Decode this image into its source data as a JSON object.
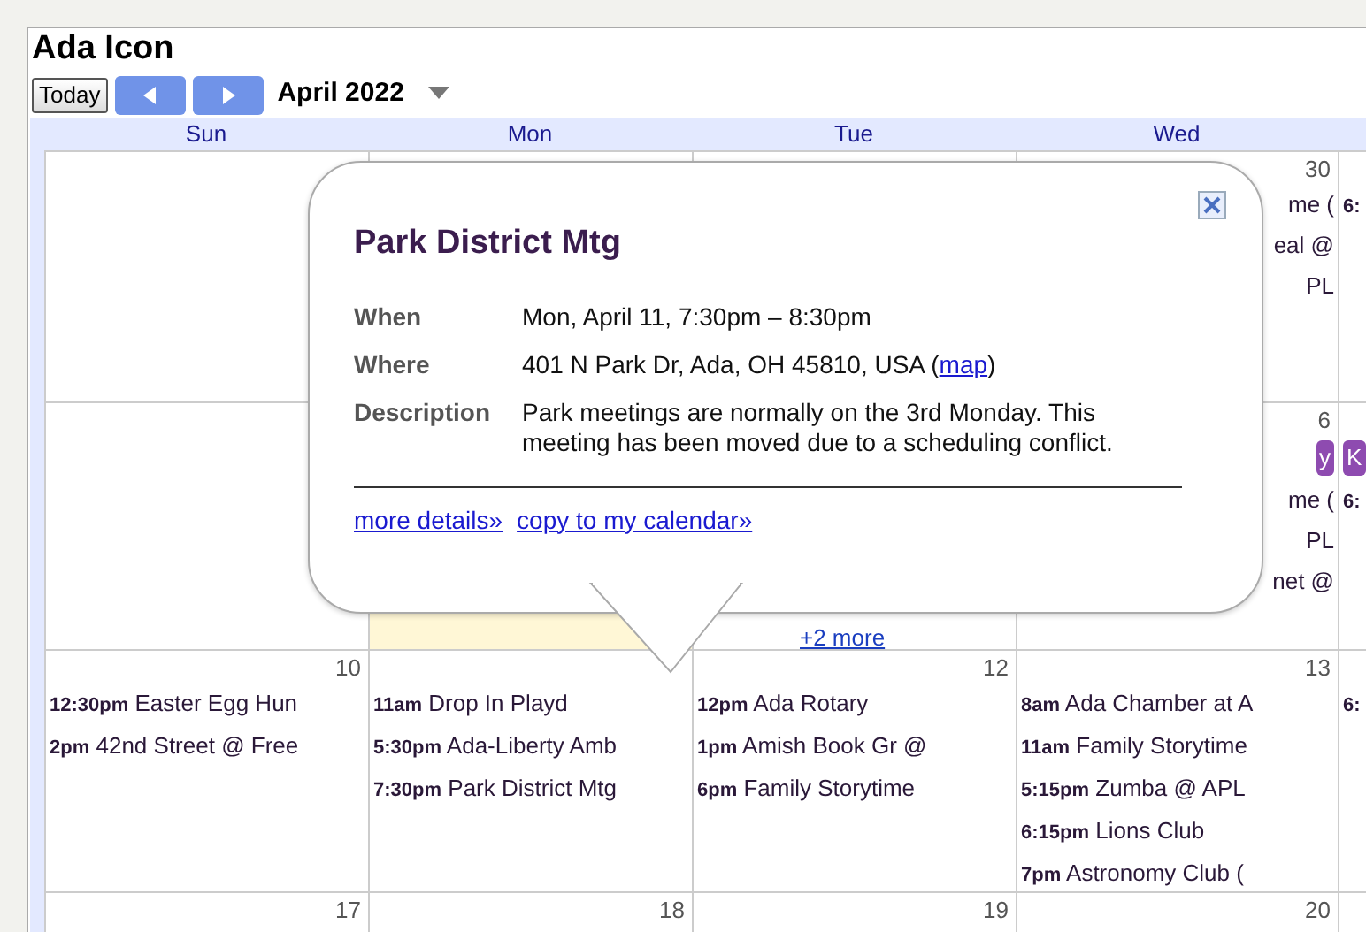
{
  "title": "Ada Icon",
  "toolbar": {
    "today": "Today",
    "month": "April 2022"
  },
  "weekdays": [
    "Sun",
    "Mon",
    "Tue",
    "Wed"
  ],
  "weeks": [
    {
      "days": [
        {
          "today": false
        },
        {
          "today": false
        },
        {
          "today": false
        },
        {
          "date": "30",
          "today": false,
          "events": [
            {
              "kind": "fragment",
              "title": "me ("
            },
            {
              "kind": "fragment",
              "title": "eal @"
            },
            {
              "kind": "fragment",
              "title": "PL"
            }
          ]
        },
        {
          "today": false,
          "events": [
            {
              "kind": "timed",
              "time": "6:"
            }
          ]
        }
      ]
    },
    {
      "days": [
        {
          "today": false
        },
        {
          "today": true
        },
        {
          "today": false,
          "more": "+2 more"
        },
        {
          "date": "6",
          "today": false,
          "events": [
            {
              "kind": "chipfragment",
              "title": "y"
            },
            {
              "kind": "fragment",
              "title": "me ("
            },
            {
              "kind": "fragment",
              "title": "PL"
            },
            {
              "kind": "fragment",
              "title": "net @"
            }
          ]
        },
        {
          "today": false,
          "events": [
            {
              "kind": "chip",
              "title": "K"
            },
            {
              "kind": "timed",
              "time": "6:"
            }
          ]
        }
      ]
    },
    {
      "days": [
        {
          "date": "10",
          "today": false,
          "events": [
            {
              "kind": "timed",
              "time": "12:30pm",
              "title": "Easter Egg Hun"
            },
            {
              "kind": "timed",
              "time": "2pm",
              "title": "42nd Street @ Free"
            }
          ]
        },
        {
          "today": false,
          "events": [
            {
              "kind": "timed",
              "time": "11am",
              "title": "Drop In Playd"
            },
            {
              "kind": "timed",
              "time": "5:30pm",
              "title": "Ada-Liberty Amb"
            },
            {
              "kind": "timed",
              "time": "7:30pm",
              "title": "Park District Mtg"
            }
          ]
        },
        {
          "date": "12",
          "today": false,
          "events": [
            {
              "kind": "timed",
              "time": "12pm",
              "title": "Ada Rotary"
            },
            {
              "kind": "timed",
              "time": "1pm",
              "title": "Amish Book Gr @"
            },
            {
              "kind": "timed",
              "time": "6pm",
              "title": "Family Storytime"
            }
          ]
        },
        {
          "date": "13",
          "today": false,
          "events": [
            {
              "kind": "timed",
              "time": "8am",
              "title": "Ada Chamber at A"
            },
            {
              "kind": "timed",
              "time": "11am",
              "title": "Family Storytime"
            },
            {
              "kind": "timed",
              "time": "5:15pm",
              "title": "Zumba @ APL"
            },
            {
              "kind": "timed",
              "time": "6:15pm",
              "title": "Lions Club"
            },
            {
              "kind": "timed",
              "time": "7pm",
              "title": "Astronomy Club ("
            }
          ]
        },
        {
          "today": false,
          "events": [
            {
              "kind": "timed",
              "time": "6:"
            }
          ]
        }
      ]
    },
    {
      "days": [
        {
          "date": "17",
          "today": false
        },
        {
          "date": "18",
          "today": false
        },
        {
          "date": "19",
          "today": false
        },
        {
          "date": "20",
          "today": false
        },
        {
          "today": false
        }
      ]
    }
  ],
  "popup": {
    "title": "Park District Mtg",
    "rows": [
      {
        "label": "When",
        "value": "Mon, April 11, 7:30pm – 8:30pm"
      },
      {
        "label": "Where",
        "value": "401 N Park Dr, Ada, OH 45810, USA (",
        "link": "map",
        "after": ")"
      },
      {
        "label": "Description",
        "value": "Park meetings are normally on the 3rd Monday. This meeting has been moved due to a scheduling conflict."
      }
    ],
    "links": [
      "more details»",
      "copy to my calendar»"
    ]
  }
}
